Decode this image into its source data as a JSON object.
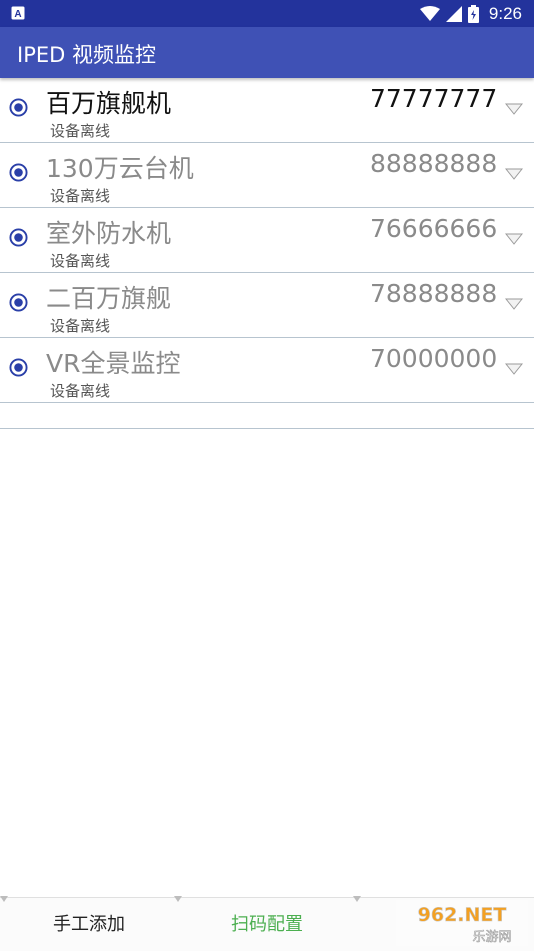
{
  "status_bar": {
    "time": "9:26",
    "notification_icon": "a-icon",
    "icons": [
      "wifi-icon",
      "signal-icon",
      "battery-icon"
    ]
  },
  "app_bar": {
    "title": "IPED 视频监控"
  },
  "devices": [
    {
      "name": "百万旗舰机",
      "number": "77777777",
      "status": "设备离线",
      "active": true
    },
    {
      "name": "130万云台机",
      "number": "88888888",
      "status": "设备离线",
      "active": false
    },
    {
      "name": "室外防水机",
      "number": "76666666",
      "status": "设备离线",
      "active": false
    },
    {
      "name": "二百万旗舰",
      "number": "78888888",
      "status": "设备离线",
      "active": false
    },
    {
      "name": "VR全景监控",
      "number": "70000000",
      "status": "设备离线",
      "active": false
    }
  ],
  "bottom_tabs": [
    {
      "label": "手工添加"
    },
    {
      "label": "扫码配置"
    },
    {
      "label": ""
    }
  ],
  "watermark": {
    "line1": "962.NET",
    "line2": "乐游网"
  },
  "colors": {
    "status_bar": "#23339c",
    "app_bar": "#3f51b5",
    "radio": "#2a3fa8",
    "active_tab": "#4caf50",
    "divider": "#b7c4cf"
  }
}
